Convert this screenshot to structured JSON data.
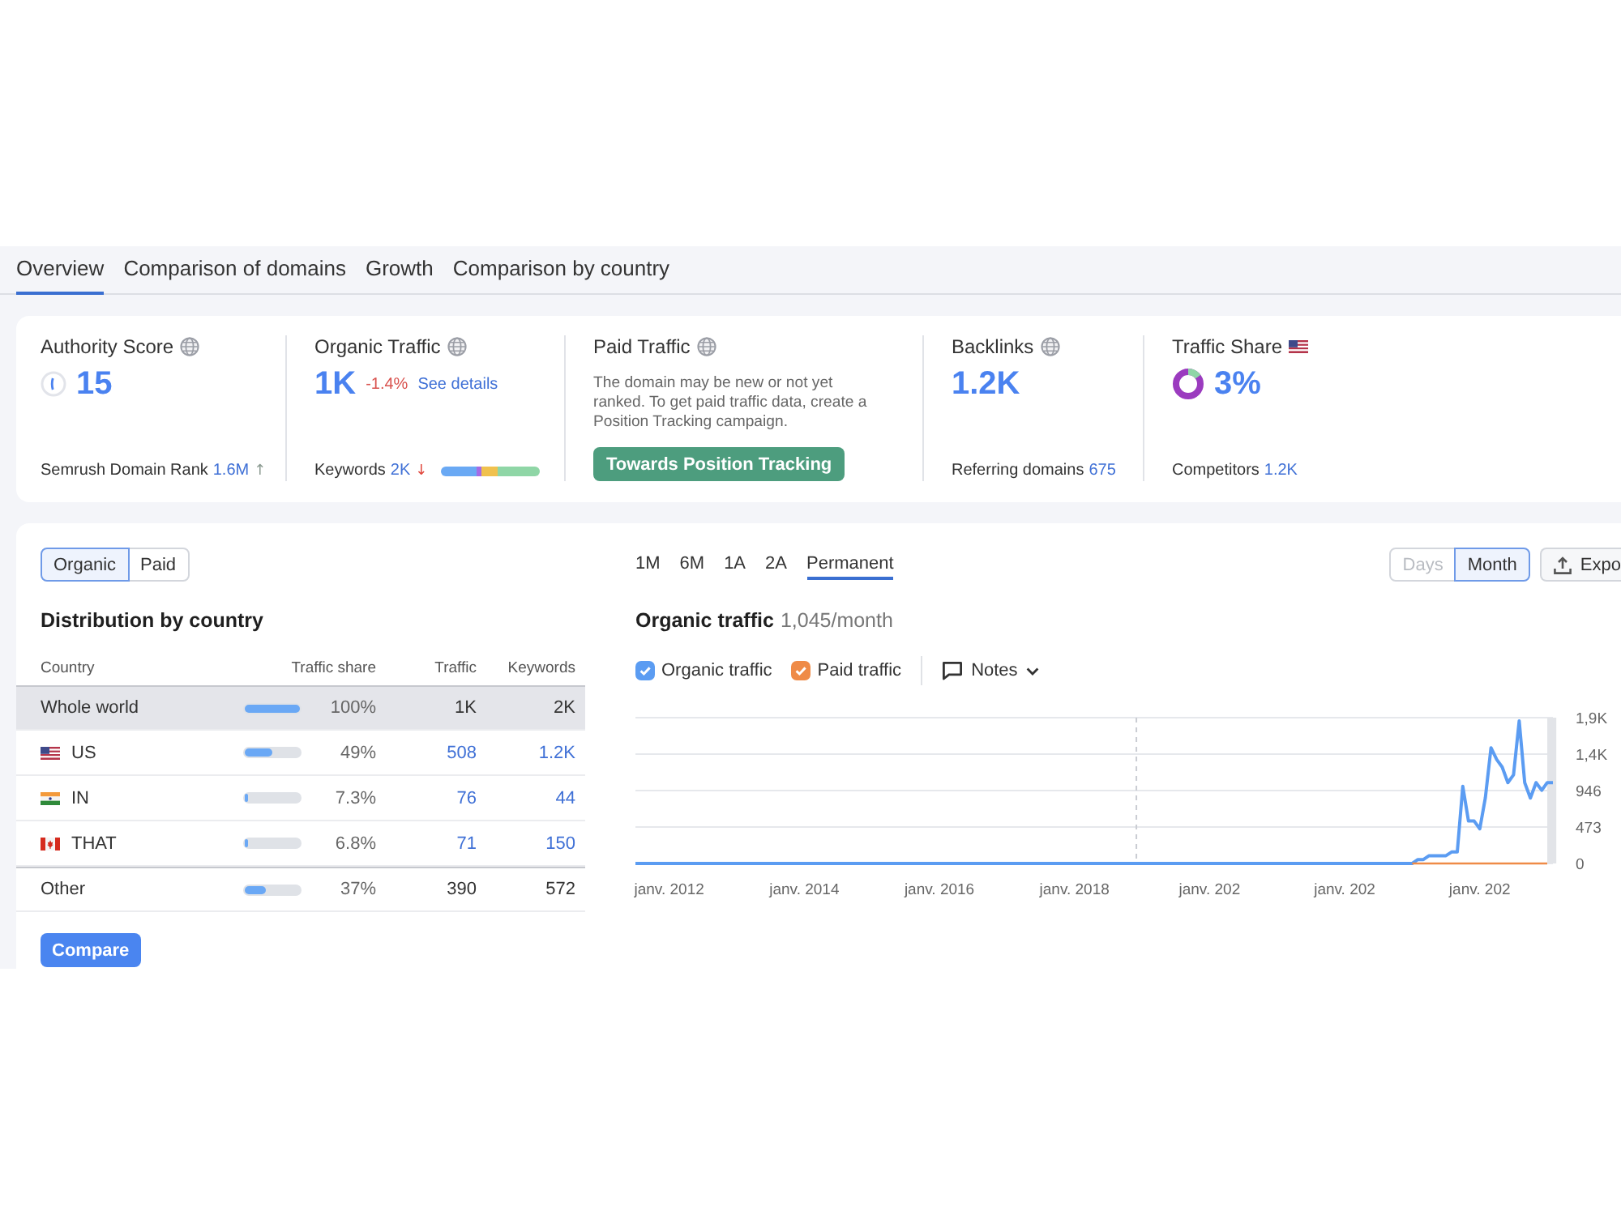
{
  "tabs": [
    {
      "label": "Overview",
      "selected": true
    },
    {
      "label": "Comparison of domains",
      "selected": false
    },
    {
      "label": "Growth",
      "selected": false
    },
    {
      "label": "Comparison by country",
      "selected": false
    }
  ],
  "metrics": [
    {
      "kind": "score",
      "title": "Authority Score",
      "value": "15",
      "footer_label": "Semrush Domain Rank",
      "footer_value": "1.6M",
      "trend": "↑",
      "negative": false
    },
    {
      "kind": "traffic",
      "title": "Organic Traffic",
      "value": "1K",
      "change": "-1.4%",
      "link": "See details",
      "footer_label": "Keywords",
      "footer_value": "2K",
      "trend": "↓",
      "negative": true
    },
    {
      "kind": "paid",
      "title": "Paid Traffic",
      "description": "The domain may be new or not yet ranked. To get paid traffic data, create a Position Tracking campaign.",
      "button": "Towards Position Tracking"
    },
    {
      "kind": "backlinks",
      "title": "Backlinks",
      "value": "1.2K",
      "footer_label": "Referring domains",
      "footer_value": "675"
    },
    {
      "kind": "share",
      "title": "Traffic Share",
      "value": "3%",
      "footer_label": "Competitors",
      "footer_value": "1.2K"
    }
  ],
  "distribution": {
    "toggle": [
      {
        "label": "Organic",
        "selected": true
      },
      {
        "label": "Paid",
        "selected": false
      }
    ],
    "title": "Distribution by country",
    "columns": [
      "Country",
      "Traffic share",
      "Traffic",
      "Keywords"
    ],
    "rows": [
      {
        "kind": "total",
        "selected": true,
        "country": "Whole world",
        "level": 1,
        "share": "100%",
        "traffic": "1K",
        "keywords": "2K"
      },
      {
        "kind": "country",
        "selected": false,
        "country": "US",
        "level": 0.49,
        "share": "49%",
        "traffic": "508",
        "keywords": "1.2K"
      },
      {
        "kind": "country",
        "selected": false,
        "country": "IN",
        "level": 0.073,
        "share": "7.3%",
        "traffic": "76",
        "keywords": "44"
      },
      {
        "kind": "country",
        "selected": false,
        "country": "THAT",
        "level": 0.068,
        "share": "6.8%",
        "traffic": "71",
        "keywords": "150"
      },
      {
        "kind": "other",
        "selected": false,
        "country": "Other",
        "level": 0.37,
        "share": "37%",
        "traffic": "390",
        "keywords": "572"
      }
    ],
    "compare_button": "Compare"
  },
  "traffic": {
    "periods": [
      {
        "label": "1M",
        "selected": false
      },
      {
        "label": "6M",
        "selected": false
      },
      {
        "label": "1A",
        "selected": false
      },
      {
        "label": "2A",
        "selected": false
      },
      {
        "label": "Permanent",
        "selected": true
      }
    ],
    "granularity": [
      {
        "label": "Days",
        "selected": false,
        "disabled": true
      },
      {
        "label": "Month",
        "selected": true,
        "disabled": false
      }
    ],
    "export_button": "Expo",
    "title": "Organic traffic",
    "subtitle": "1,045/month",
    "legend": [
      {
        "checked": true
      },
      {
        "checked": true
      }
    ],
    "notes_button": "Notes",
    "chart_data": {
      "type": "line",
      "grid": true,
      "categories": [
        null,
        null,
        null,
        null,
        null,
        null,
        "janv. 2012",
        null,
        null,
        null,
        null,
        null,
        null,
        null,
        null,
        null,
        null,
        null,
        null,
        null,
        null,
        null,
        null,
        null,
        null,
        null,
        null,
        null,
        null,
        null,
        "janv. 2014",
        null,
        null,
        null,
        null,
        null,
        null,
        null,
        null,
        null,
        null,
        null,
        null,
        null,
        null,
        null,
        null,
        null,
        null,
        null,
        null,
        null,
        null,
        null,
        "janv. 2016",
        null,
        null,
        null,
        null,
        null,
        null,
        null,
        null,
        null,
        null,
        null,
        null,
        null,
        null,
        null,
        null,
        null,
        null,
        null,
        null,
        null,
        null,
        null,
        "janv. 2018",
        null,
        null,
        null,
        null,
        null,
        null,
        null,
        null,
        null,
        null,
        null,
        null,
        null,
        null,
        null,
        null,
        null,
        null,
        null,
        null,
        null,
        null,
        null,
        "janv. 202",
        null,
        null,
        null,
        null,
        null,
        null,
        null,
        null,
        null,
        null,
        null,
        null,
        null,
        null,
        null,
        null,
        null,
        null,
        null,
        null,
        null,
        null,
        null,
        "janv. 202",
        null,
        null,
        null,
        null,
        null,
        null,
        null,
        null,
        null,
        null,
        null,
        null,
        null,
        null,
        null,
        null,
        null,
        null,
        null,
        null,
        null,
        null,
        null,
        "janv. 202",
        null,
        null,
        null,
        null,
        null,
        null,
        null,
        null,
        null,
        null,
        null,
        null,
        null
      ],
      "series": [
        {
          "name": "Organic traffic",
          "color": "#5b9cf2",
          "values": [
            0,
            0,
            0,
            0,
            0,
            0,
            0,
            0,
            0,
            0,
            0,
            0,
            0,
            0,
            0,
            0,
            0,
            0,
            0,
            0,
            0,
            0,
            0,
            0,
            0,
            0,
            0,
            0,
            0,
            0,
            0,
            0,
            0,
            0,
            0,
            0,
            0,
            0,
            0,
            0,
            0,
            0,
            0,
            0,
            0,
            0,
            0,
            0,
            0,
            0,
            0,
            0,
            0,
            0,
            0,
            0,
            0,
            0,
            0,
            0,
            0,
            0,
            0,
            0,
            0,
            0,
            0,
            0,
            0,
            0,
            0,
            0,
            0,
            0,
            0,
            0,
            0,
            0,
            0,
            0,
            0,
            0,
            0,
            0,
            0,
            0,
            0,
            0,
            0,
            0,
            0,
            0,
            0,
            0,
            0,
            0,
            0,
            0,
            0,
            0,
            0,
            0,
            0,
            0,
            0,
            0,
            0,
            0,
            0,
            0,
            0,
            0,
            0,
            0,
            0,
            0,
            0,
            0,
            0,
            0,
            0,
            0,
            0,
            0,
            0,
            0,
            0,
            0,
            0,
            0,
            0,
            0,
            0,
            0,
            0,
            0,
            0,
            0,
            0,
            50,
            50,
            100,
            100,
            100,
            100,
            150,
            150,
            1000,
            550,
            550,
            450,
            850,
            1500,
            1350,
            1250,
            1050,
            1150,
            1850,
            1050,
            850,
            1050,
            950,
            1050,
            1050
          ]
        },
        {
          "name": "Paid traffic",
          "color": "#ef8b47",
          "values": [
            null,
            null,
            null,
            null,
            null,
            null,
            null,
            null,
            null,
            null,
            null,
            null,
            null,
            null,
            null,
            null,
            null,
            null,
            null,
            null,
            null,
            null,
            null,
            null,
            null,
            null,
            null,
            null,
            null,
            null,
            null,
            null,
            null,
            null,
            null,
            null,
            null,
            null,
            null,
            null,
            null,
            null,
            null,
            null,
            null,
            null,
            null,
            null,
            null,
            null,
            null,
            null,
            null,
            null,
            null,
            null,
            null,
            null,
            null,
            null,
            null,
            null,
            null,
            null,
            null,
            null,
            null,
            null,
            null,
            null,
            null,
            null,
            null,
            null,
            null,
            null,
            null,
            null,
            null,
            null,
            null,
            null,
            null,
            null,
            null,
            null,
            null,
            null,
            null,
            null,
            null,
            null,
            null,
            null,
            null,
            null,
            null,
            null,
            null,
            null,
            null,
            null,
            null,
            null,
            null,
            null,
            null,
            null,
            null,
            null,
            null,
            null,
            null,
            null,
            null,
            null,
            null,
            null,
            null,
            null,
            null,
            null,
            null,
            null,
            null,
            null,
            null,
            null,
            null,
            null,
            null,
            null,
            null,
            null,
            null,
            null,
            null,
            null,
            0,
            0,
            0,
            0,
            0,
            0,
            0,
            0,
            0,
            0,
            0,
            0,
            0,
            0,
            0,
            0,
            0,
            0,
            0,
            0,
            0,
            0,
            0,
            0,
            0,
            null
          ]
        }
      ],
      "ylim": [
        0,
        1892
      ],
      "yticks": [
        {
          "value": 0,
          "label": "0"
        },
        {
          "value": 473,
          "label": "473"
        },
        {
          "value": 946,
          "label": "946"
        },
        {
          "value": 1419,
          "label": "1,4K"
        },
        {
          "value": 1892,
          "label": "1,9K"
        }
      ]
    }
  }
}
